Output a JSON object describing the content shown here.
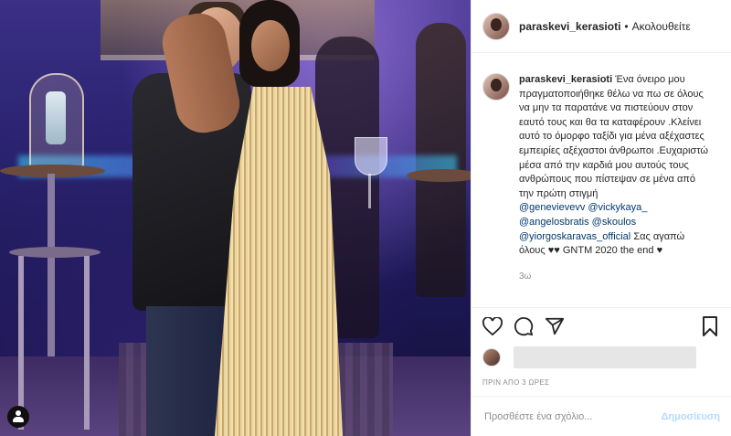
{
  "post": {
    "username": "paraskevi_kerasioti",
    "follow_label": "Ακολουθείτε",
    "dot": "•",
    "caption_text": "Ένα όνειρο μου πραγματοποιήθηκε θέλω να πω σε όλους να μην τα παρατάνε να πιστεύουν στον εαυτό τους και θα τα καταφέρουν .Κλείνει αυτό το όμορφο ταξίδι για μένα αξέχαστες εμπειρίες αξέχαστοι άνθρωποι .Ευχαριστώ μέσα από την καρδιά μου αυτούς τους ανθρώπους που πίστεψαν σε μένα από την πρώτη στιγμή",
    "mentions": [
      "@genevievevv",
      "@vickykaya_",
      "@angelosbratis",
      "@skoulos",
      "@yiorgoskaravas_official"
    ],
    "caption_tail": "Σας αγαπώ όλους ♥♥ GNTM 2020 the end ♥",
    "caption_time": "3ω",
    "time_ago": "ΠΡΙΝ ΑΠΟ 3 ΩΡΕΣ",
    "comment_placeholder": "Προσθέστε ένα σχόλιο...",
    "post_button": "Δημοσίευση"
  },
  "icons": [
    "heart-icon",
    "comment-icon",
    "share-icon",
    "bookmark-icon",
    "user-tag-icon"
  ],
  "colors": {
    "link": "#00376b",
    "muted": "#8e8e8e",
    "post_button_disabled": "#b3dbff"
  }
}
